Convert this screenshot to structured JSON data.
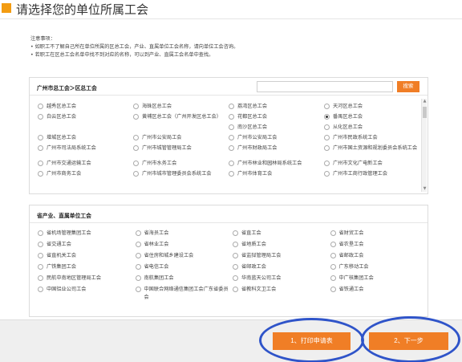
{
  "header": {
    "title": "请选择您的单位所属工会"
  },
  "notice": {
    "heading": "注意事项：",
    "lines": [
      "• 如职工不了解自己所在单位所属的区总工会，产业、直属单位工会名称，请向单位工会咨询。",
      "• 若职工在区总工会名单中找不到对应的名称，可以到产业、直属工会名单中查找。"
    ]
  },
  "district_panel": {
    "title": "广州市总工会＞区总工会",
    "search_placeholder": "",
    "search_label": "搜索",
    "rows": [
      [
        "越秀区总工会",
        "海珠区总工会",
        "荔湾区总工会",
        "天河区总工会"
      ],
      [
        "白云区总工会",
        "黄埔区总工会（广州开发区总工会）",
        "花都区总工会",
        "番禺区总工会"
      ],
      [
        "",
        "",
        "南沙区总工会",
        "从化区总工会"
      ],
      [
        "增城区总工会",
        "广州市公安局工会",
        "广州市公安局工会",
        "广州市民政系统工会"
      ],
      [
        "广州市司法局系统工会",
        "广州市城管管理局工会",
        "广州市财政局工会",
        "广州市国土资源和规划委员会系统工会"
      ],
      [
        "广州市交通运输工会",
        "广州市水务工会",
        "广州市林业和园林局系统工会",
        "广州市文化广电新工会"
      ],
      [
        "广州市商务工会",
        "广州市城市管理委员会系统工会",
        "广州市体育工会",
        "广州市工商行政管理工会"
      ]
    ],
    "checked": "番禺区总工会"
  },
  "industry_panel": {
    "title": "省产业、直属单位工会",
    "rows": [
      [
        "省机场管理集团工会",
        "省海员工会",
        "省直工会",
        "省财贸工会"
      ],
      [
        "省交通工会",
        "省林业工会",
        "省地质工会",
        "省农垦工会"
      ],
      [
        "省直机关工会",
        "省住房和城乡建设工会",
        "省监狱管理局工会",
        "省邮政工会"
      ],
      [
        "广铁集团工会",
        "省电信工会",
        "省邮政工会",
        "广东移动工会"
      ],
      [
        "民航中南地区管理局工会",
        "南航集团工会",
        "华南蓝天公司工会",
        "中广核集团工会"
      ],
      [
        "中国铝业公司工会",
        "中国联合网络通信集团工会广东省委员会",
        "省教科文卫工会",
        "省铁通工会"
      ]
    ]
  },
  "actions": {
    "print_label": "1、打印申请表",
    "next_label": "2、下一步"
  },
  "colors": {
    "accent": "#f07e26",
    "annotation": "#2f54c9"
  }
}
